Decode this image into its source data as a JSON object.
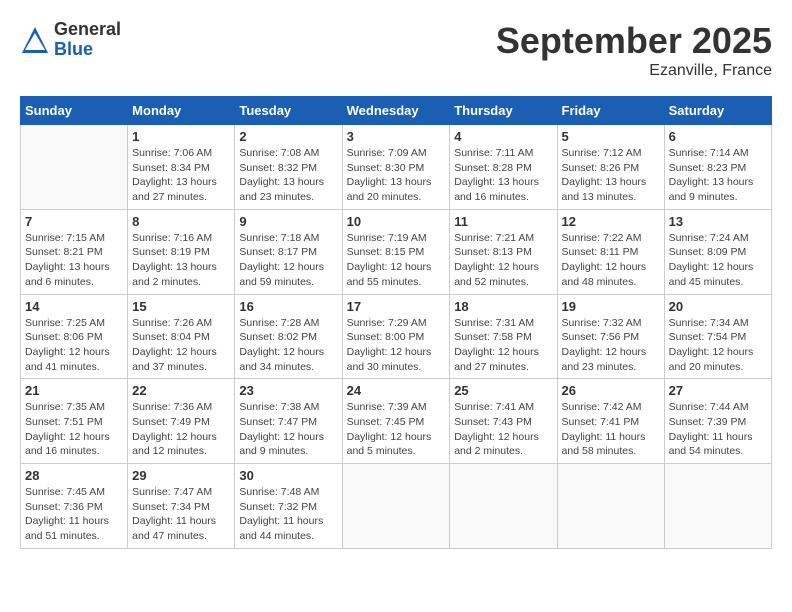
{
  "logo": {
    "general": "General",
    "blue": "Blue"
  },
  "title": "September 2025",
  "location": "Ezanville, France",
  "days_of_week": [
    "Sunday",
    "Monday",
    "Tuesday",
    "Wednesday",
    "Thursday",
    "Friday",
    "Saturday"
  ],
  "weeks": [
    [
      {
        "day": "",
        "info": ""
      },
      {
        "day": "1",
        "info": "Sunrise: 7:06 AM\nSunset: 8:34 PM\nDaylight: 13 hours\nand 27 minutes."
      },
      {
        "day": "2",
        "info": "Sunrise: 7:08 AM\nSunset: 8:32 PM\nDaylight: 13 hours\nand 23 minutes."
      },
      {
        "day": "3",
        "info": "Sunrise: 7:09 AM\nSunset: 8:30 PM\nDaylight: 13 hours\nand 20 minutes."
      },
      {
        "day": "4",
        "info": "Sunrise: 7:11 AM\nSunset: 8:28 PM\nDaylight: 13 hours\nand 16 minutes."
      },
      {
        "day": "5",
        "info": "Sunrise: 7:12 AM\nSunset: 8:26 PM\nDaylight: 13 hours\nand 13 minutes."
      },
      {
        "day": "6",
        "info": "Sunrise: 7:14 AM\nSunset: 8:23 PM\nDaylight: 13 hours\nand 9 minutes."
      }
    ],
    [
      {
        "day": "7",
        "info": "Sunrise: 7:15 AM\nSunset: 8:21 PM\nDaylight: 13 hours\nand 6 minutes."
      },
      {
        "day": "8",
        "info": "Sunrise: 7:16 AM\nSunset: 8:19 PM\nDaylight: 13 hours\nand 2 minutes."
      },
      {
        "day": "9",
        "info": "Sunrise: 7:18 AM\nSunset: 8:17 PM\nDaylight: 12 hours\nand 59 minutes."
      },
      {
        "day": "10",
        "info": "Sunrise: 7:19 AM\nSunset: 8:15 PM\nDaylight: 12 hours\nand 55 minutes."
      },
      {
        "day": "11",
        "info": "Sunrise: 7:21 AM\nSunset: 8:13 PM\nDaylight: 12 hours\nand 52 minutes."
      },
      {
        "day": "12",
        "info": "Sunrise: 7:22 AM\nSunset: 8:11 PM\nDaylight: 12 hours\nand 48 minutes."
      },
      {
        "day": "13",
        "info": "Sunrise: 7:24 AM\nSunset: 8:09 PM\nDaylight: 12 hours\nand 45 minutes."
      }
    ],
    [
      {
        "day": "14",
        "info": "Sunrise: 7:25 AM\nSunset: 8:06 PM\nDaylight: 12 hours\nand 41 minutes."
      },
      {
        "day": "15",
        "info": "Sunrise: 7:26 AM\nSunset: 8:04 PM\nDaylight: 12 hours\nand 37 minutes."
      },
      {
        "day": "16",
        "info": "Sunrise: 7:28 AM\nSunset: 8:02 PM\nDaylight: 12 hours\nand 34 minutes."
      },
      {
        "day": "17",
        "info": "Sunrise: 7:29 AM\nSunset: 8:00 PM\nDaylight: 12 hours\nand 30 minutes."
      },
      {
        "day": "18",
        "info": "Sunrise: 7:31 AM\nSunset: 7:58 PM\nDaylight: 12 hours\nand 27 minutes."
      },
      {
        "day": "19",
        "info": "Sunrise: 7:32 AM\nSunset: 7:56 PM\nDaylight: 12 hours\nand 23 minutes."
      },
      {
        "day": "20",
        "info": "Sunrise: 7:34 AM\nSunset: 7:54 PM\nDaylight: 12 hours\nand 20 minutes."
      }
    ],
    [
      {
        "day": "21",
        "info": "Sunrise: 7:35 AM\nSunset: 7:51 PM\nDaylight: 12 hours\nand 16 minutes."
      },
      {
        "day": "22",
        "info": "Sunrise: 7:36 AM\nSunset: 7:49 PM\nDaylight: 12 hours\nand 12 minutes."
      },
      {
        "day": "23",
        "info": "Sunrise: 7:38 AM\nSunset: 7:47 PM\nDaylight: 12 hours\nand 9 minutes."
      },
      {
        "day": "24",
        "info": "Sunrise: 7:39 AM\nSunset: 7:45 PM\nDaylight: 12 hours\nand 5 minutes."
      },
      {
        "day": "25",
        "info": "Sunrise: 7:41 AM\nSunset: 7:43 PM\nDaylight: 12 hours\nand 2 minutes."
      },
      {
        "day": "26",
        "info": "Sunrise: 7:42 AM\nSunset: 7:41 PM\nDaylight: 11 hours\nand 58 minutes."
      },
      {
        "day": "27",
        "info": "Sunrise: 7:44 AM\nSunset: 7:39 PM\nDaylight: 11 hours\nand 54 minutes."
      }
    ],
    [
      {
        "day": "28",
        "info": "Sunrise: 7:45 AM\nSunset: 7:36 PM\nDaylight: 11 hours\nand 51 minutes."
      },
      {
        "day": "29",
        "info": "Sunrise: 7:47 AM\nSunset: 7:34 PM\nDaylight: 11 hours\nand 47 minutes."
      },
      {
        "day": "30",
        "info": "Sunrise: 7:48 AM\nSunset: 7:32 PM\nDaylight: 11 hours\nand 44 minutes."
      },
      {
        "day": "",
        "info": ""
      },
      {
        "day": "",
        "info": ""
      },
      {
        "day": "",
        "info": ""
      },
      {
        "day": "",
        "info": ""
      }
    ]
  ]
}
